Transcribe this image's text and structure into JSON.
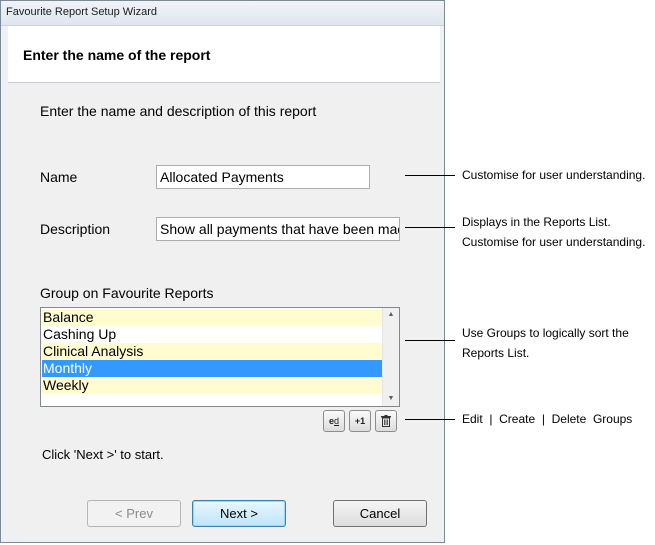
{
  "window": {
    "title": "Favourite Report Setup Wizard"
  },
  "header": {
    "heading": "Enter the name of the report"
  },
  "form": {
    "intro": "Enter the name and description of this report",
    "name_label": "Name",
    "name_value": "Allocated Payments",
    "description_label": "Description",
    "description_value": "Show all payments that have been made",
    "group_label": "Group on Favourite Reports",
    "groups": [
      "Balance",
      "Cashing Up",
      "Clinical Analysis",
      "Monthly",
      "Weekly"
    ],
    "selected_group": "Monthly",
    "hint": "Click 'Next >' to start."
  },
  "group_buttons": {
    "edit": "e",
    "add": "+1"
  },
  "buttons": {
    "prev": "< Prev",
    "next": "Next >",
    "cancel": "Cancel"
  },
  "callouts": {
    "name": "Customise for user understanding.",
    "description_line1": "Displays in the Reports List.",
    "description_line2": "Customise for user understanding.",
    "groups_line1": "Use Groups to logically sort the",
    "groups_line2": "Reports List.",
    "group_buttons": "Edit  |  Create  |  Delete  Groups"
  },
  "icons": {
    "edit": "edit-icon",
    "add": "add-icon",
    "delete": "trash-icon"
  },
  "colors": {
    "selection": "#3399ff",
    "alt_row": "#fffdd0"
  }
}
